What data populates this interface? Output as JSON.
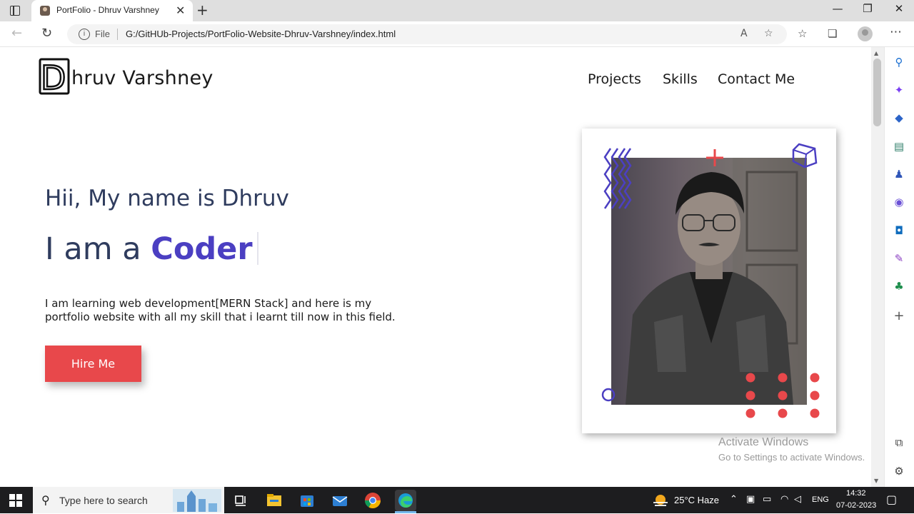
{
  "browser": {
    "tab_title": "PortFolio - Dhruv Varshney",
    "tab_close": "✕",
    "new_tab": "+",
    "minimize": "—",
    "maximize": "❐",
    "close": "✕",
    "url_scheme": "File",
    "url": "G:/GitHUb-Projects/PortFolio-Website-Dhruv-Varshney/index.html",
    "icons": [
      "back-icon",
      "refresh-icon",
      "info-icon",
      "read-aloud-icon",
      "add-favorite-icon",
      "favorites-icon",
      "collections-icon",
      "profile-icon",
      "more-icon"
    ]
  },
  "site": {
    "logo_letter": "D",
    "logo_rest": "hruv Varshney",
    "nav": [
      "Projects",
      "Skills",
      "Contact Me"
    ],
    "greeting": "Hii, My name is Dhruv",
    "role_prefix": "I am a",
    "role": "Coder",
    "description": "I am learning web development[MERN Stack] and here is my portfolio website with all my skill that i learnt till now in this field.",
    "hire_button": "Hire Me",
    "accent_color": "#4b3fc2",
    "button_color": "#e8484b"
  },
  "watermark": {
    "title": "Activate Windows",
    "subtitle": "Go to Settings to activate Windows."
  },
  "taskbar": {
    "search_placeholder": "Type here to search",
    "weather": "25°C  Haze",
    "language": "ENG",
    "time": "14:32",
    "date": "07-02-2023"
  },
  "edge_sidebar": [
    "search-icon",
    "copilot-icon",
    "shopping-icon",
    "tools-icon",
    "games-icon",
    "office-icon",
    "outlook-icon",
    "designer-icon",
    "tree-icon",
    "add-icon",
    "split-screen-icon",
    "settings-icon"
  ]
}
